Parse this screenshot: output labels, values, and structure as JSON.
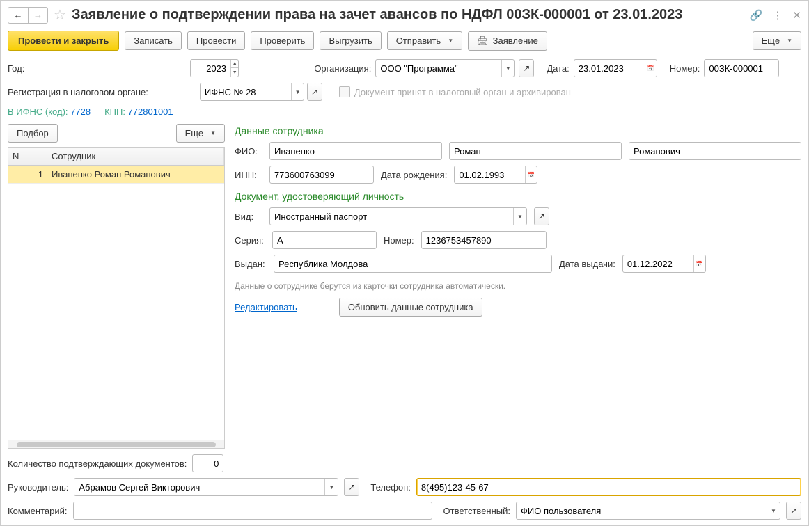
{
  "title": "Заявление о подтверждении права на зачет авансов по НДФЛ 00ЗК-000001 от 23.01.2023",
  "toolbar": {
    "post_close": "Провести и закрыть",
    "save": "Записать",
    "post": "Провести",
    "check": "Проверить",
    "export": "Выгрузить",
    "send": "Отправить",
    "application": "Заявление",
    "more": "Еще"
  },
  "fields": {
    "year_label": "Год:",
    "year_value": "2023",
    "org_label": "Организация:",
    "org_value": "ООО \"Программа\"",
    "date_label": "Дата:",
    "date_value": "23.01.2023",
    "number_label": "Номер:",
    "number_value": "00ЗК-000001",
    "reg_label": "Регистрация в налоговом органе:",
    "reg_value": "ИФНС № 28",
    "archive_label": "Документ принят в налоговый орган и архивирован"
  },
  "meta": {
    "ifns": "В ИФНС (код): 7728",
    "kpp": "КПП: 772801001"
  },
  "left": {
    "pick": "Подбор",
    "more": "Еще",
    "col_n": "N",
    "col_emp": "Сотрудник",
    "rows": [
      {
        "n": "1",
        "emp": "Иваненко Роман Романович"
      }
    ],
    "count_label": "Количество подтверждающих документов:",
    "count_value": "0"
  },
  "emp": {
    "section1": "Данные сотрудника",
    "fio_label": "ФИО:",
    "last": "Иваненко",
    "first": "Роман",
    "mid": "Романович",
    "inn_label": "ИНН:",
    "inn": "773600763099",
    "dob_label": "Дата рождения:",
    "dob": "01.02.1993",
    "section2": "Документ, удостоверяющий личность",
    "kind_label": "Вид:",
    "kind": "Иностранный паспорт",
    "series_label": "Серия:",
    "series": "А",
    "num_label": "Номер:",
    "num": "1236753457890",
    "issued_label": "Выдан:",
    "issued": "Республика Молдова",
    "idate_label": "Дата выдачи:",
    "idate": "01.12.2022",
    "hint": "Данные о сотруднике берутся из карточки сотрудника автоматически.",
    "edit": "Редактировать",
    "refresh": "Обновить данные сотрудника"
  },
  "footer": {
    "mgr_label": "Руководитель:",
    "mgr": "Абрамов Сергей Викторович",
    "phone_label": "Телефон:",
    "phone": "8(495)123-45-67",
    "comment_label": "Комментарий:",
    "resp_label": "Ответственный:",
    "resp": "ФИО пользователя"
  }
}
